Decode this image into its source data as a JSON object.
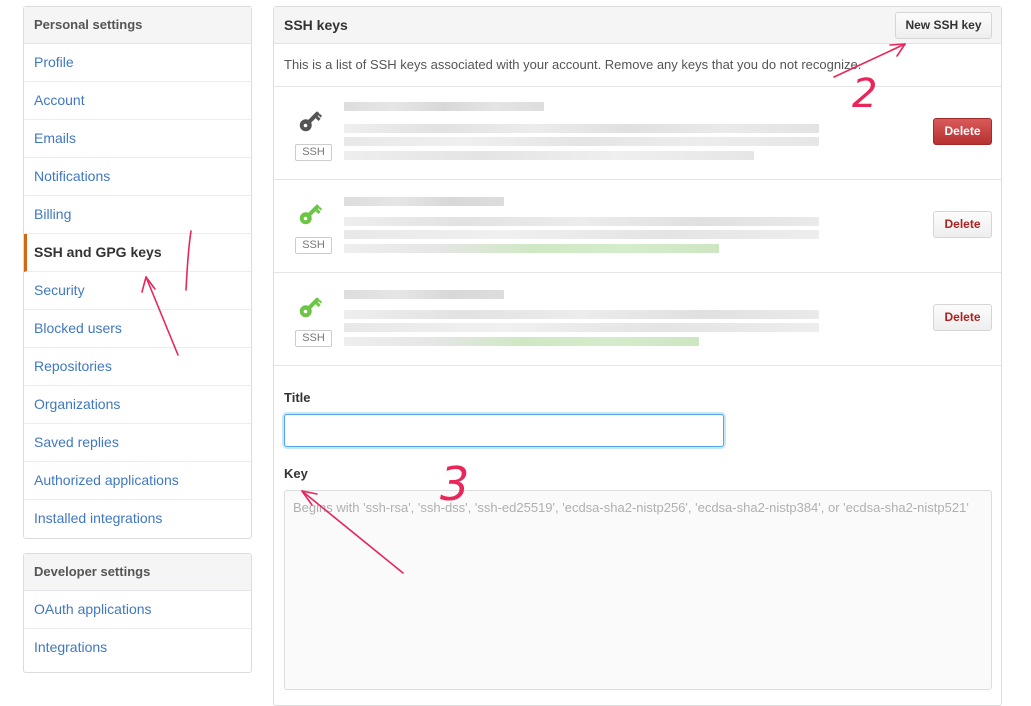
{
  "personal": {
    "heading": "Personal settings",
    "items": [
      {
        "label": "Profile"
      },
      {
        "label": "Account"
      },
      {
        "label": "Emails"
      },
      {
        "label": "Notifications"
      },
      {
        "label": "Billing"
      },
      {
        "label": "SSH and GPG keys",
        "selected": true
      },
      {
        "label": "Security"
      },
      {
        "label": "Blocked users"
      },
      {
        "label": "Repositories"
      },
      {
        "label": "Organizations"
      },
      {
        "label": "Saved replies"
      },
      {
        "label": "Authorized applications"
      },
      {
        "label": "Installed integrations"
      }
    ]
  },
  "developer": {
    "heading": "Developer settings",
    "items": [
      {
        "label": "OAuth applications"
      },
      {
        "label": "Integrations"
      }
    ]
  },
  "ssh": {
    "title": "SSH keys",
    "new_button": "New SSH key",
    "intro": "This is a list of SSH keys associated with your account. Remove any keys that you do not recognize.",
    "keys": [
      {
        "tag": "SSH",
        "delete_label": "Delete",
        "icon_color": "#555555"
      },
      {
        "tag": "SSH",
        "delete_label": "Delete",
        "icon_color": "#6cc644"
      },
      {
        "tag": "SSH",
        "delete_label": "Delete",
        "icon_color": "#6cc644"
      }
    ]
  },
  "form": {
    "title_label": "Title",
    "key_label": "Key",
    "key_placeholder": "Begins with 'ssh-rsa', 'ssh-dss', 'ssh-ed25519', 'ecdsa-sha2-nistp256', 'ecdsa-sha2-nistp384', or 'ecdsa-sha2-nistp521'"
  },
  "annotations": {
    "step2": "2",
    "step3": "3"
  }
}
